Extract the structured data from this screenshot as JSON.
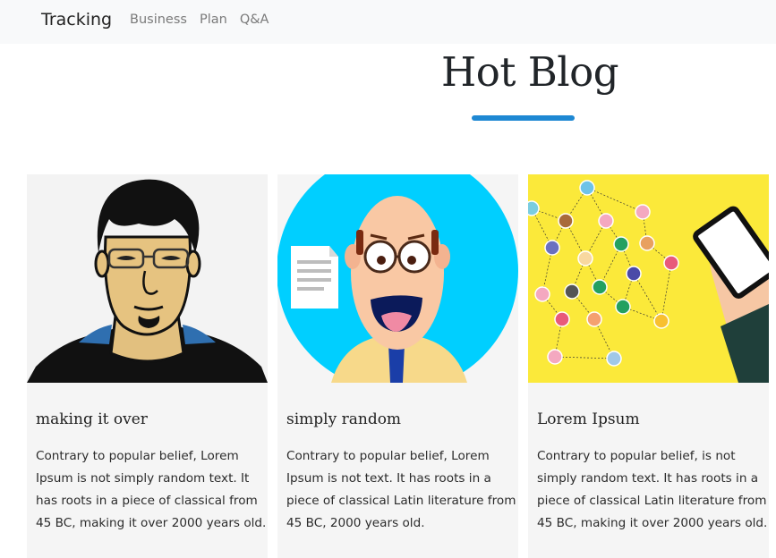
{
  "navbar": {
    "brand": "Tracking",
    "links": [
      "Business",
      "Plan",
      "Q&A"
    ]
  },
  "section": {
    "title": "Hot Blog",
    "accent_color": "#1e88d3"
  },
  "cards": [
    {
      "title": "making it over",
      "text": "Contrary to popular belief, Lorem Ipsum is not simply random text. It has roots in a piece of classical from 45 BC, making it over 2000 years old.",
      "image": "man-with-glasses-avatar"
    },
    {
      "title": "simply random",
      "text": "Contrary to popular belief, Lorem Ipsum is not text. It has roots in a piece of classical Latin literature from 45 BC, 2000 years old.",
      "image": "bald-teacher-avatar"
    },
    {
      "title": "Lorem Ipsum",
      "text": "Contrary to popular belief, is not simply random text. It has roots in a piece of classical Latin literature from 45 BC, making it over 2000 years old.",
      "image": "social-network-illustration"
    }
  ]
}
